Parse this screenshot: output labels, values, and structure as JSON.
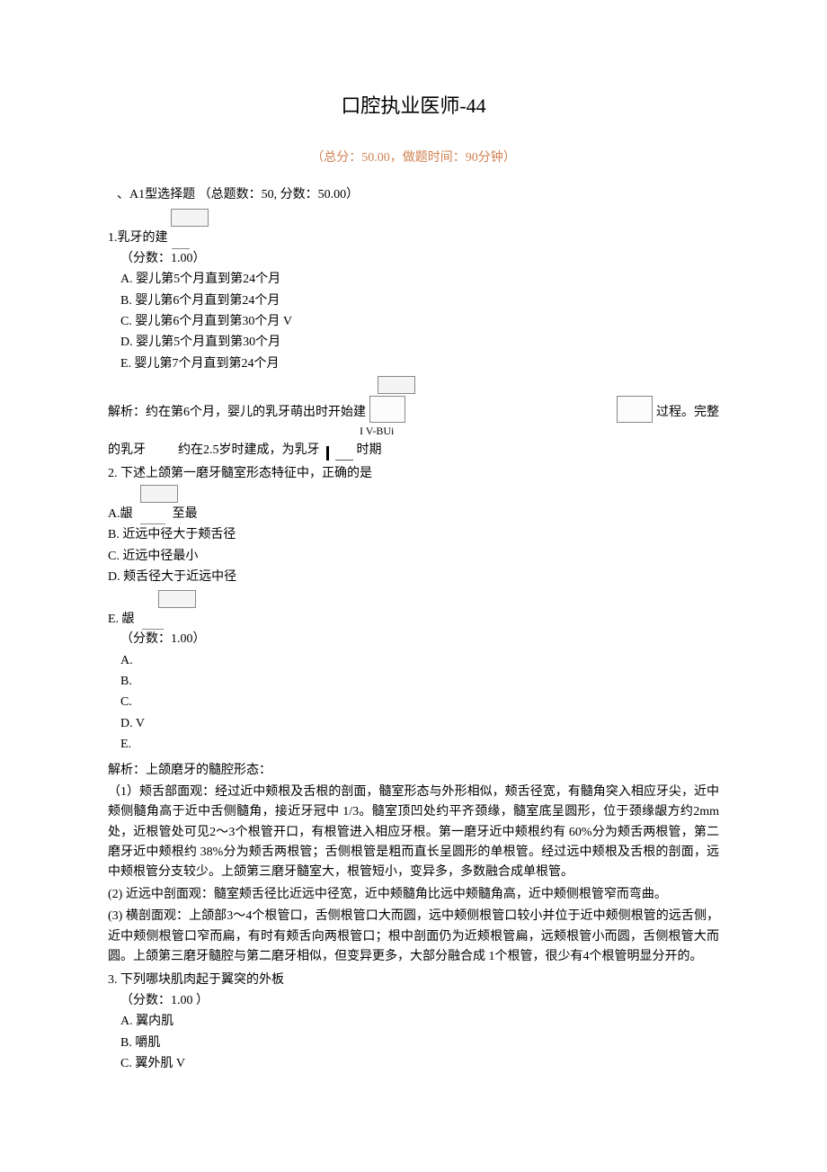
{
  "title": "口腔执业医师-44",
  "meta": "（总分：50.00，做题时间：90分钟）",
  "section_header": "、A1型选择题 （总题数：50, 分数：50.00）",
  "q1": {
    "stem_prefix": "1.乳牙的建",
    "score": "（分数：1.00）",
    "opts": {
      "A": "A.  婴儿第5个月直到第24个月",
      "B": "B.  婴儿第6个月直到第24个月",
      "C": "C.  婴儿第6个月直到第30个月  V",
      "D": "D.  婴儿第5个月直到第30个月",
      "E": "E.  婴儿第7个月直到第24个月"
    },
    "analysis_line1_left": "解析：约在第6个月，婴儿的乳牙萌出时开始建",
    "analysis_line1_right": "过程。完整",
    "mid_label": "I V-BUi",
    "analysis_line2_left": "的乳牙",
    "analysis_line2_mid": "约在2.5岁时建成，为乳牙",
    "analysis_line2_right": "时期"
  },
  "q2": {
    "stem": "2.      下述上颌第一磨牙髓室形态特征中，正确的是",
    "A_label": "A.龈",
    "A_right": "至最",
    "B": "B.      近远中径大于颊舌径",
    "C": "C.      近远中径最小",
    "D": "D.      颊舌径大于近远中径",
    "E_label": "E.  龈",
    "score": "（分数：1.00）",
    "ans": {
      "A": "A.",
      "B": "B.",
      "C": "C.",
      "D": "D.    V",
      "E": "E."
    },
    "analysis_head": "解析：上颌磨牙的髓腔形态：",
    "p1": "（1）颊舌部面观：经过近中颊根及舌根的剖面，髓室形态与外形相似，颊舌径宽，有髓角突入相应牙尖，近中颊侧髓角高于近中舌侧髓角，接近牙冠中      1/3。髓室顶凹处约平齐颈缘，髓室底呈圆形，位于颈缘龈方约2mm处，近根管处可见2～3个根管开口，有根管进入相应牙根。第一磨牙近中颊根约有           60%分为颊舌两根管，第二磨牙近中颊根约  38%分为颊舌两根管；舌侧根管是粗而直长呈圆形的单根管。经过远中颊根及舌根的剖面，远中颊根管分支较少。上颌第三磨牙髓室大，根管短小，变异多，多数融合成单根管。",
    "p2": "(2) 近远中剖面观：髓室颊舌径比近远中径宽，近中颊髓角比远中颊髓角高，近中颊侧根管窄而弯曲。",
    "p3": "(3) 横剖面观：上颌部3～4个根管口，舌侧根管口大而圆，远中颊侧根管口较小并位于近中颊侧根管的远舌侧，近中颊侧根管口窄而扁，有时有颊舌向两根管口；根中剖面仍为近颊根管扁，远颊根管小而圆，舌侧根管大而圆。上颌第三磨牙髓腔与第二磨牙相似，但变异更多，大部分融合成         1个根管，很少有4个根管明显分开的。"
  },
  "q3": {
    "stem": "3.      下列哪块肌肉起于翼突的外板",
    "score": "（分数：1.00 ）",
    "A": "A.  翼内肌",
    "B": "B.  嚼肌",
    "C": "C.  翼外肌  V"
  }
}
